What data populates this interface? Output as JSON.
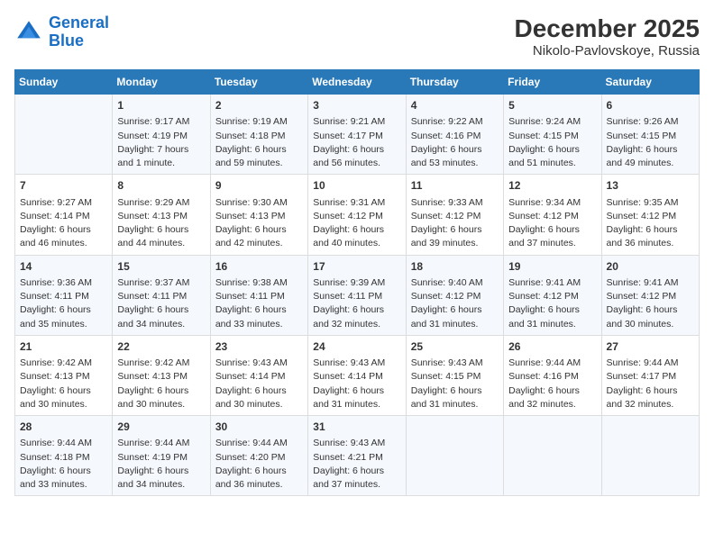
{
  "logo": {
    "line1": "General",
    "line2": "Blue"
  },
  "title": "December 2025",
  "subtitle": "Nikolo-Pavlovskoye, Russia",
  "days_of_week": [
    "Sunday",
    "Monday",
    "Tuesday",
    "Wednesday",
    "Thursday",
    "Friday",
    "Saturday"
  ],
  "weeks": [
    [
      {
        "day": "",
        "info": ""
      },
      {
        "day": "1",
        "info": "Sunrise: 9:17 AM\nSunset: 4:19 PM\nDaylight: 7 hours\nand 1 minute."
      },
      {
        "day": "2",
        "info": "Sunrise: 9:19 AM\nSunset: 4:18 PM\nDaylight: 6 hours\nand 59 minutes."
      },
      {
        "day": "3",
        "info": "Sunrise: 9:21 AM\nSunset: 4:17 PM\nDaylight: 6 hours\nand 56 minutes."
      },
      {
        "day": "4",
        "info": "Sunrise: 9:22 AM\nSunset: 4:16 PM\nDaylight: 6 hours\nand 53 minutes."
      },
      {
        "day": "5",
        "info": "Sunrise: 9:24 AM\nSunset: 4:15 PM\nDaylight: 6 hours\nand 51 minutes."
      },
      {
        "day": "6",
        "info": "Sunrise: 9:26 AM\nSunset: 4:15 PM\nDaylight: 6 hours\nand 49 minutes."
      }
    ],
    [
      {
        "day": "7",
        "info": "Sunrise: 9:27 AM\nSunset: 4:14 PM\nDaylight: 6 hours\nand 46 minutes."
      },
      {
        "day": "8",
        "info": "Sunrise: 9:29 AM\nSunset: 4:13 PM\nDaylight: 6 hours\nand 44 minutes."
      },
      {
        "day": "9",
        "info": "Sunrise: 9:30 AM\nSunset: 4:13 PM\nDaylight: 6 hours\nand 42 minutes."
      },
      {
        "day": "10",
        "info": "Sunrise: 9:31 AM\nSunset: 4:12 PM\nDaylight: 6 hours\nand 40 minutes."
      },
      {
        "day": "11",
        "info": "Sunrise: 9:33 AM\nSunset: 4:12 PM\nDaylight: 6 hours\nand 39 minutes."
      },
      {
        "day": "12",
        "info": "Sunrise: 9:34 AM\nSunset: 4:12 PM\nDaylight: 6 hours\nand 37 minutes."
      },
      {
        "day": "13",
        "info": "Sunrise: 9:35 AM\nSunset: 4:12 PM\nDaylight: 6 hours\nand 36 minutes."
      }
    ],
    [
      {
        "day": "14",
        "info": "Sunrise: 9:36 AM\nSunset: 4:11 PM\nDaylight: 6 hours\nand 35 minutes."
      },
      {
        "day": "15",
        "info": "Sunrise: 9:37 AM\nSunset: 4:11 PM\nDaylight: 6 hours\nand 34 minutes."
      },
      {
        "day": "16",
        "info": "Sunrise: 9:38 AM\nSunset: 4:11 PM\nDaylight: 6 hours\nand 33 minutes."
      },
      {
        "day": "17",
        "info": "Sunrise: 9:39 AM\nSunset: 4:11 PM\nDaylight: 6 hours\nand 32 minutes."
      },
      {
        "day": "18",
        "info": "Sunrise: 9:40 AM\nSunset: 4:12 PM\nDaylight: 6 hours\nand 31 minutes."
      },
      {
        "day": "19",
        "info": "Sunrise: 9:41 AM\nSunset: 4:12 PM\nDaylight: 6 hours\nand 31 minutes."
      },
      {
        "day": "20",
        "info": "Sunrise: 9:41 AM\nSunset: 4:12 PM\nDaylight: 6 hours\nand 30 minutes."
      }
    ],
    [
      {
        "day": "21",
        "info": "Sunrise: 9:42 AM\nSunset: 4:13 PM\nDaylight: 6 hours\nand 30 minutes."
      },
      {
        "day": "22",
        "info": "Sunrise: 9:42 AM\nSunset: 4:13 PM\nDaylight: 6 hours\nand 30 minutes."
      },
      {
        "day": "23",
        "info": "Sunrise: 9:43 AM\nSunset: 4:14 PM\nDaylight: 6 hours\nand 30 minutes."
      },
      {
        "day": "24",
        "info": "Sunrise: 9:43 AM\nSunset: 4:14 PM\nDaylight: 6 hours\nand 31 minutes."
      },
      {
        "day": "25",
        "info": "Sunrise: 9:43 AM\nSunset: 4:15 PM\nDaylight: 6 hours\nand 31 minutes."
      },
      {
        "day": "26",
        "info": "Sunrise: 9:44 AM\nSunset: 4:16 PM\nDaylight: 6 hours\nand 32 minutes."
      },
      {
        "day": "27",
        "info": "Sunrise: 9:44 AM\nSunset: 4:17 PM\nDaylight: 6 hours\nand 32 minutes."
      }
    ],
    [
      {
        "day": "28",
        "info": "Sunrise: 9:44 AM\nSunset: 4:18 PM\nDaylight: 6 hours\nand 33 minutes."
      },
      {
        "day": "29",
        "info": "Sunrise: 9:44 AM\nSunset: 4:19 PM\nDaylight: 6 hours\nand 34 minutes."
      },
      {
        "day": "30",
        "info": "Sunrise: 9:44 AM\nSunset: 4:20 PM\nDaylight: 6 hours\nand 36 minutes."
      },
      {
        "day": "31",
        "info": "Sunrise: 9:43 AM\nSunset: 4:21 PM\nDaylight: 6 hours\nand 37 minutes."
      },
      {
        "day": "",
        "info": ""
      },
      {
        "day": "",
        "info": ""
      },
      {
        "day": "",
        "info": ""
      }
    ]
  ]
}
